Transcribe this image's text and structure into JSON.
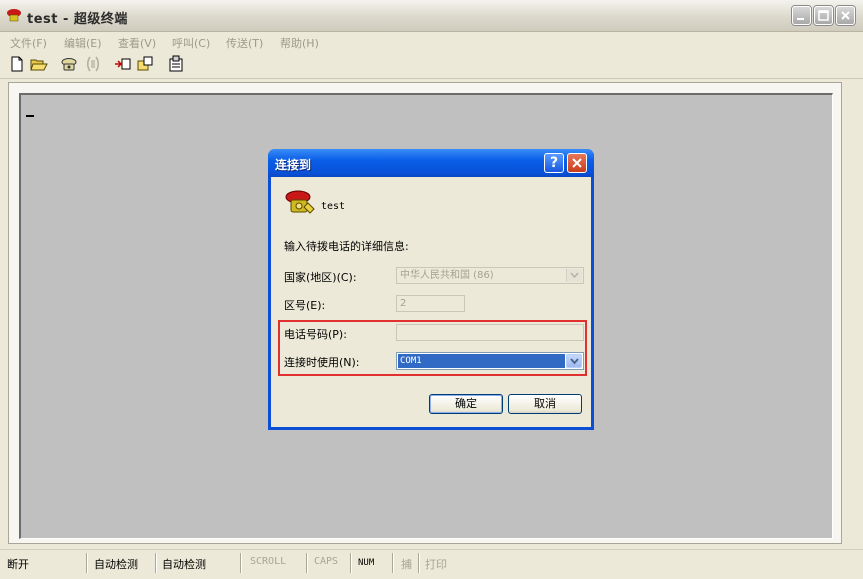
{
  "window": {
    "title": "test - 超级终端"
  },
  "menu": [
    "文件(F)",
    "编辑(E)",
    "查看(V)",
    "呼叫(C)",
    "传送(T)",
    "帮助(H)"
  ],
  "toolbar": {
    "icons": [
      "new-icon",
      "open-icon",
      "dial-icon",
      "disconnect-icon",
      "send-icon",
      "receive-icon",
      "properties-icon"
    ]
  },
  "dialog": {
    "title": "连接到",
    "help_label": "?",
    "connection_name": "test",
    "instruction": "输入待拨电话的详细信息:",
    "country_label": "国家(地区)(C):",
    "country_value": "中华人民共和国 (86)",
    "area_label": "区号(E):",
    "area_value": "2",
    "phone_label": "电话号码(P):",
    "phone_value": "",
    "connect_using_label": "连接时使用(N):",
    "connect_using_value": "COM1",
    "ok_label": "确定",
    "cancel_label": "取消"
  },
  "status": {
    "state": "断开",
    "detect1": "自动检测",
    "detect2": "自动检测",
    "scroll": "SCROLL",
    "caps": "CAPS",
    "num": "NUM",
    "capture": "捕",
    "print": "打印"
  },
  "colors": {
    "dialog_border": "#0a4fd6",
    "highlight": "#e03030",
    "terminal_bg": "#c0c0c0",
    "selection": "#316ac5"
  }
}
